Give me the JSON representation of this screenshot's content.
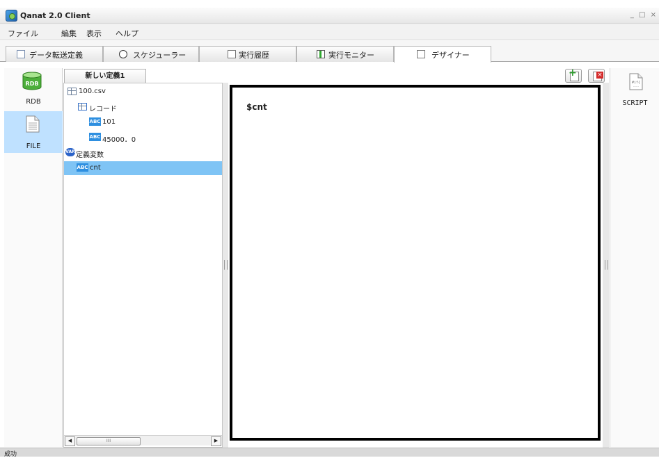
{
  "window": {
    "title": "Qanat 2.0 Client",
    "controls": "_ □ ×"
  },
  "menu": [
    {
      "label": "ファイル"
    },
    {
      "label": "編集"
    },
    {
      "label": "表示"
    },
    {
      "label": "ヘルプ"
    }
  ],
  "tabs": [
    {
      "label": "データ転送定義",
      "icon": "document-icon"
    },
    {
      "label": "スケジューラー",
      "icon": "clock-icon"
    },
    {
      "label": "実行履歴",
      "icon": "history-icon"
    },
    {
      "label": "実行モニター",
      "icon": "play-icon"
    },
    {
      "label": "デザイナー",
      "icon": "designer-icon",
      "active": true
    }
  ],
  "left_panel": {
    "items": [
      {
        "label": "RDB",
        "icon": "database-icon"
      },
      {
        "label": "FILE",
        "icon": "file-icon",
        "selected": true
      }
    ]
  },
  "tree": {
    "tab_label": "新しい定義1",
    "rows": [
      {
        "label": "100.csv",
        "icon": "grid-icon"
      },
      {
        "label": "レコード",
        "icon": "table-icon"
      },
      {
        "label": "101",
        "icon": "abc-icon",
        "icon_text": "ABC"
      },
      {
        "label": "45000．0",
        "icon": "abc-icon",
        "icon_text": "ABC"
      },
      {
        "label": "定義変数",
        "icon": "var-icon",
        "icon_text": "VAR"
      },
      {
        "label": "cnt",
        "icon": "abc-icon",
        "icon_text": "ABC",
        "selected": true
      }
    ],
    "scroll_thumb": "IIII"
  },
  "editor": {
    "content": "$cnt"
  },
  "right_panel": {
    "items": [
      {
        "label": "SCRIPT",
        "icon": "script-icon"
      }
    ]
  },
  "status": {
    "text": "成功"
  },
  "colors": {
    "selection": "#bfe1ff",
    "tree_selection": "#7fc4f5",
    "abc_icon": "#2e8fe0",
    "editor_border": "#000000"
  }
}
